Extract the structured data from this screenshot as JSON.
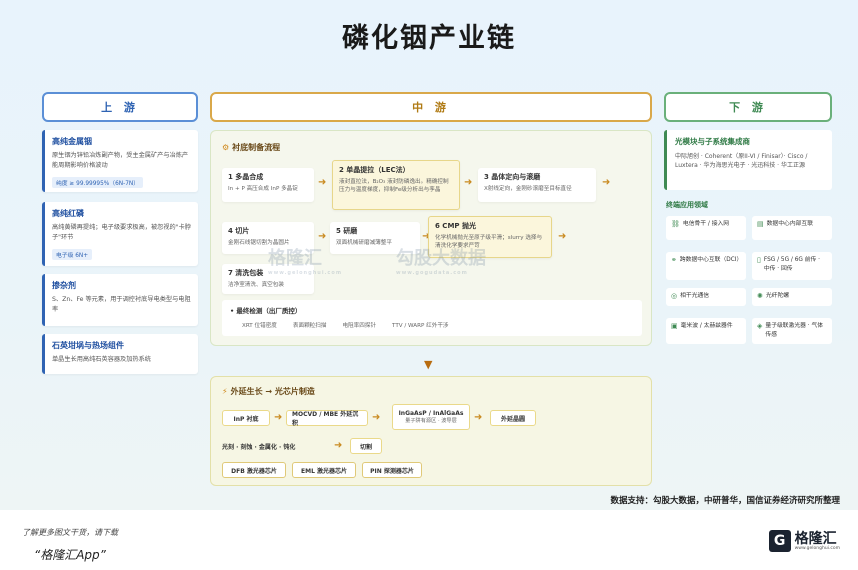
{
  "title": "磷化铟产业链",
  "stages": {
    "up": "上 游",
    "mid": "中 游",
    "down": "下 游"
  },
  "upstream": [
    {
      "title": "高纯金属铟",
      "desc": "原生铟为锌铅冶炼副产物，受主金属矿产与冶炼产能周期影响价格波动",
      "badge": "纯度 ≥ 99.99995%（6N-7N）"
    },
    {
      "title": "高纯红磷",
      "desc": "高纯黄磷再提纯；电子级要求极高，被忽视的\"卡脖子\"环节",
      "badge": "电子级 6N+"
    },
    {
      "title": "掺杂剂",
      "desc": "S、Zn、Fe 等元素，用于调控衬底导电类型与电阻率"
    },
    {
      "title": "石英坩埚与热场组件",
      "desc": "单晶生长用高纯石英容器及加热系统"
    }
  ],
  "substrate": {
    "section_title": "衬底制备流程",
    "steps": [
      {
        "title": "1 多晶合成",
        "desc": "In + P 高压合成 InP 多晶锭"
      },
      {
        "title": "2 单晶提拉（LEC法）",
        "desc": "液封直拉法，B₂O₃ 液封防磷逸出。精确控制压力与温度梯度，抑制Fe级分析出与孪晶"
      },
      {
        "title": "3 晶体定向与滚磨",
        "desc": "X射线定向，金刚砂滚磨至目标直径"
      },
      {
        "title": "4 切片",
        "desc": "金刚石线锯切割为晶圆片"
      },
      {
        "title": "5 研磨",
        "desc": "双面机械研磨减薄整平"
      },
      {
        "title": "6 CMP 抛光",
        "desc": "化学机械抛光至原子级平滑；slurry 选择与清洗化学要求严苛"
      },
      {
        "title": "7 清洗包装",
        "desc": "洁净室清洗、真空包装"
      }
    ],
    "inspection": {
      "title": "最终检测（出厂质控）",
      "items": [
        "XRT 位错密度",
        "表面颗粒扫描",
        "电阻率四探针",
        "TTV / WARP 红外干涉"
      ]
    }
  },
  "epi": {
    "section_title": "外延生长 → 光芯片制造",
    "flow": [
      "InP 衬底",
      "MOCVD / MBE 外延沉积",
      "InGaAsP / InAlGaAs",
      "外延晶圆"
    ],
    "flow_sub": "量子阱有源区 · 波导层",
    "process": [
      "光刻 · 刻蚀 · 金属化 · 钝化",
      "切割"
    ],
    "chips": [
      "DFB 激光器芯片",
      "EML 激光器芯片",
      "PIN 探测器芯片"
    ]
  },
  "downstream": {
    "top_title": "光模块与子系统集成商",
    "top_desc": "中际旭创 · Coherent（原II-VI / Finisar）· Cisco / Luxtera · 华为海思光电子 · 光迅科技 · 华工正源",
    "apps_title": "终端应用领域",
    "apps": [
      {
        "icon": "network-icon",
        "label": "电信骨干 / 接入网"
      },
      {
        "icon": "server-icon",
        "label": "数据中心内部互联"
      },
      {
        "icon": "link-icon",
        "label": "跨数据中心互联（DCI）"
      },
      {
        "icon": "mobile-icon",
        "label": "FSG / 5G / 6G 前传 · 中传 · 回传"
      },
      {
        "icon": "satellite-icon",
        "label": "相干光通信"
      },
      {
        "icon": "laser-icon",
        "label": "光纤陀螺"
      },
      {
        "icon": "wave-icon",
        "label": "毫米波 / 太赫兹器件"
      },
      {
        "icon": "quantum-icon",
        "label": "量子级联激光器 · 气体传感"
      }
    ]
  },
  "source": "数据支持：勾股大数据，中研普华，国信证券经济研究所整理",
  "footer": {
    "line1": "了解更多图文干货，请下载",
    "line2": "“格隆汇App”",
    "brand": "格隆汇",
    "url": "www.gelonghui.com"
  },
  "watermarks": {
    "a": "格隆汇",
    "a_url": "www.gelonghui.com",
    "b": "勾股大数据",
    "b_url": "www.gogudata.com"
  }
}
